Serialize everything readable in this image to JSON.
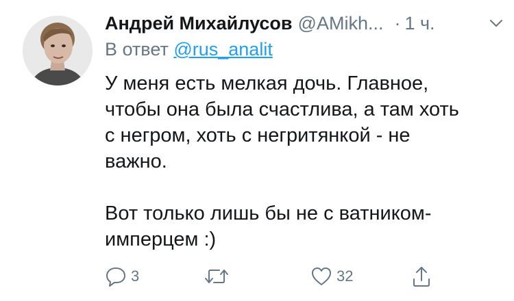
{
  "tweet": {
    "author": {
      "name": "Андрей Михайлусов",
      "handle": "@AMikh...",
      "avatar_icon": "user-photo-avatar"
    },
    "separator": "·",
    "time": "1 ч.",
    "reply_prefix": "В ответ",
    "reply_mention": "@rus_analit",
    "body": {
      "paragraph1": "У меня есть мелкая дочь. Главное, чтобы она была счастлива, а там хоть с негром, хоть с негритянкой - не важно.",
      "paragraph2": "Вот только лишь бы не с ватником-имперцем :)"
    },
    "actions": {
      "reply_count": "3",
      "retweet_count": "",
      "like_count": "32"
    },
    "icons": {
      "menu": "chevron-down-icon",
      "reply": "reply-icon",
      "retweet": "retweet-icon",
      "like": "heart-icon",
      "share": "share-icon"
    },
    "colors": {
      "text": "#14171a",
      "secondary": "#657786",
      "link": "#1da1f2"
    }
  }
}
